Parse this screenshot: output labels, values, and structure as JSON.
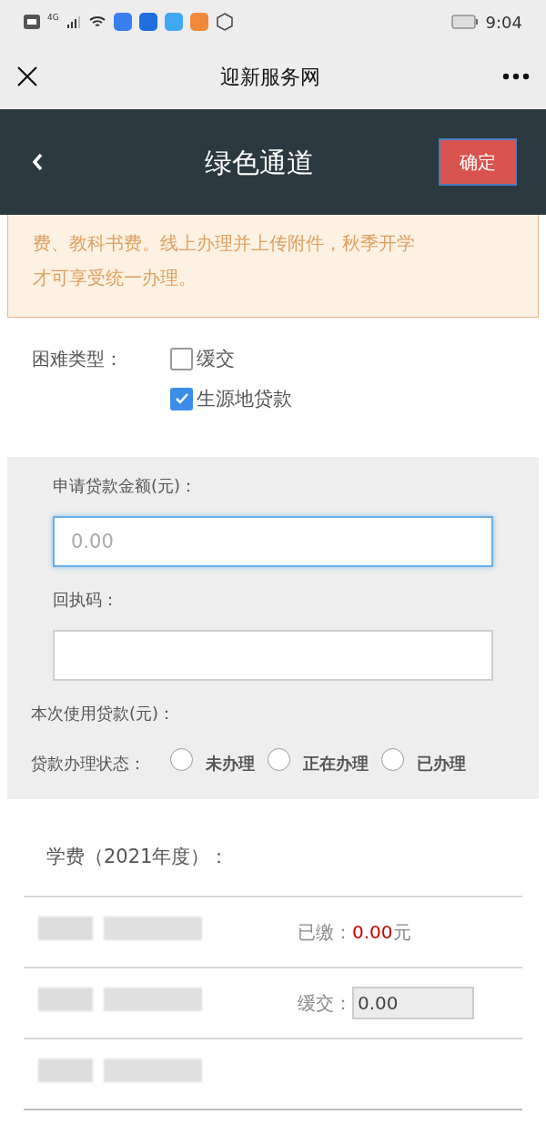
{
  "status_bar": {
    "time": "9:04",
    "network": "4G"
  },
  "title_bar": {
    "title": "迎新服务网"
  },
  "header": {
    "title": "绿色通道",
    "confirm": "确定"
  },
  "notice": {
    "lines": [
      "费、教科书费。线上办理并上传附件，秋季开学",
      "才可享受统一办理。"
    ]
  },
  "difficulty": {
    "label": "困难类型：",
    "options": [
      {
        "label": "缓交",
        "checked": false
      },
      {
        "label": "生源地贷款",
        "checked": true
      }
    ]
  },
  "loan": {
    "fields": [
      {
        "label": "申请贷款金额(元)：",
        "placeholder": "0.00",
        "focused": true
      },
      {
        "label": "回执码：",
        "focused": false
      }
    ],
    "used_label": "本次使用贷款(元)：",
    "status": {
      "label": "贷款办理状态：",
      "options": [
        {
          "label": "未办理",
          "selected": false
        },
        {
          "label": "正在办理",
          "selected": false
        },
        {
          "label": "已办理",
          "selected": false
        }
      ]
    }
  },
  "fees": {
    "title": "学费（2021年度）：",
    "rows": [
      {
        "kind": "amount",
        "label": "已缴：",
        "value": "0.00",
        "unit": "元"
      },
      {
        "kind": "field",
        "label": "缓交：",
        "value": "0.00"
      },
      {
        "kind": "empty"
      }
    ]
  }
}
